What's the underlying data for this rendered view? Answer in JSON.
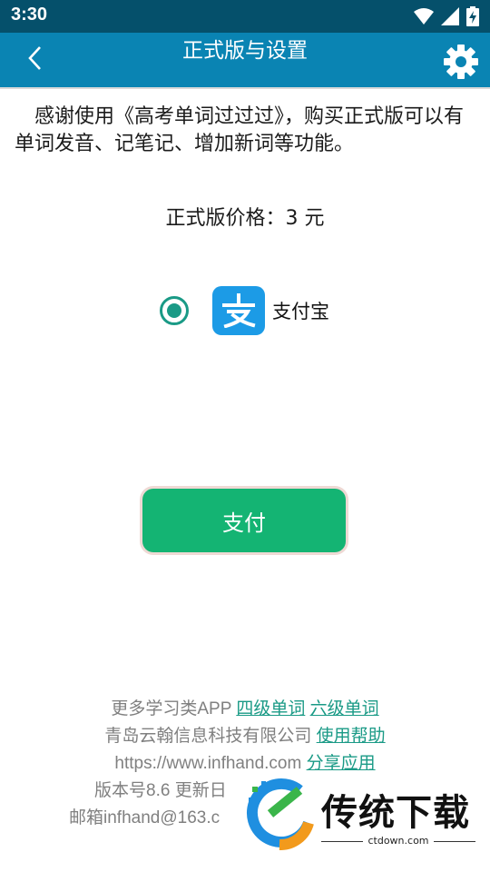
{
  "status_bar": {
    "time": "3:30"
  },
  "app_bar": {
    "title": "正式版与设置"
  },
  "intro": {
    "text": "感谢使用《高考单词过过过》，购买正式版可以有单词发音、记笔记、增加新词等功能。"
  },
  "price": {
    "text": "正式版价格：3 元"
  },
  "payment": {
    "method_label": "支付宝",
    "selected": true
  },
  "pay_button": {
    "label": "支付"
  },
  "footer": {
    "more_apps": "更多学习类APP",
    "link_cet4": "四级单词",
    "link_cet6": "六级单词",
    "company": "青岛云翰信息科技有限公司",
    "link_help": "使用帮助",
    "website": "https://www.infhand.com",
    "link_share": "分享应用",
    "version": "版本号8.6 更新日",
    "email": "邮箱infhand@163.c"
  },
  "watermark": {
    "brand": "传统下载",
    "url": "ctdown.com"
  },
  "colors": {
    "status_bar": "#05506b",
    "app_bar": "#0a84b3",
    "accent": "#1a9a86",
    "pay_button": "#14b473",
    "alipay": "#1c9be6"
  }
}
